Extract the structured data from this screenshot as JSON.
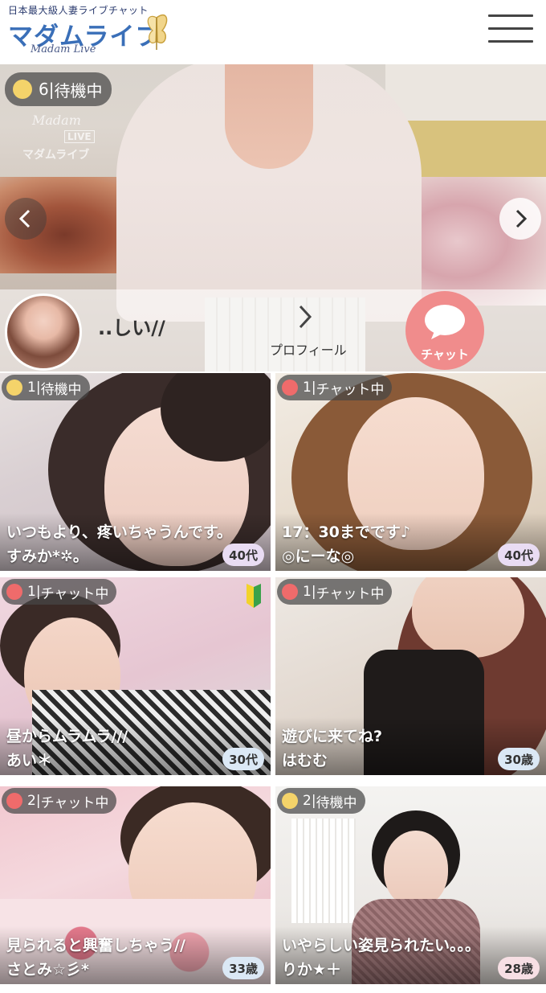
{
  "header": {
    "logo_tagline": "日本最大級人妻ライブチャット",
    "logo_main": "マダムライブ",
    "logo_sub": "Madam Live",
    "menu_icon": "hamburger-menu-icon"
  },
  "hero": {
    "status": {
      "color": "yellow",
      "count": "6",
      "text": "待機中"
    },
    "watermark": {
      "script": "Madam",
      "live": "LIVE",
      "name": "マダムライブ"
    },
    "profile_name": "..しい//",
    "profile_link_label": "プロフィール",
    "chat_label": "チャット"
  },
  "cards": [
    {
      "status_color": "yellow",
      "count": "1",
      "status": "待機中",
      "message": "いつもより、疼いちゃうんです。",
      "name": "すみか*✲。",
      "age": "40代",
      "age_style": "purple",
      "beginner": false
    },
    {
      "status_color": "red",
      "count": "1",
      "status": "チャット中",
      "message": "17：30までです♪",
      "name": "◎にーな◎",
      "age": "40代",
      "age_style": "purple",
      "beginner": false
    },
    {
      "status_color": "red",
      "count": "1",
      "status": "チャット中",
      "message": "昼からムラムラ///",
      "name": "あい＊",
      "age": "30代",
      "age_style": "blue",
      "beginner": true
    },
    {
      "status_color": "red",
      "count": "1",
      "status": "チャット中",
      "message": "遊びに来てね?",
      "name": "はむむ",
      "age": "30歳",
      "age_style": "blue",
      "beginner": false
    },
    {
      "status_color": "red",
      "count": "2",
      "status": "チャット中",
      "message": "見られると興奮しちゃう//",
      "name": "さとみ☆彡*",
      "age": "33歳",
      "age_style": "blue",
      "beginner": false
    },
    {
      "status_color": "yellow",
      "count": "2",
      "status": "待機中",
      "message": "いやらしい姿見られたい。。。",
      "name": "りか★＋",
      "age": "28歳",
      "age_style": "pink",
      "beginner": false
    }
  ]
}
